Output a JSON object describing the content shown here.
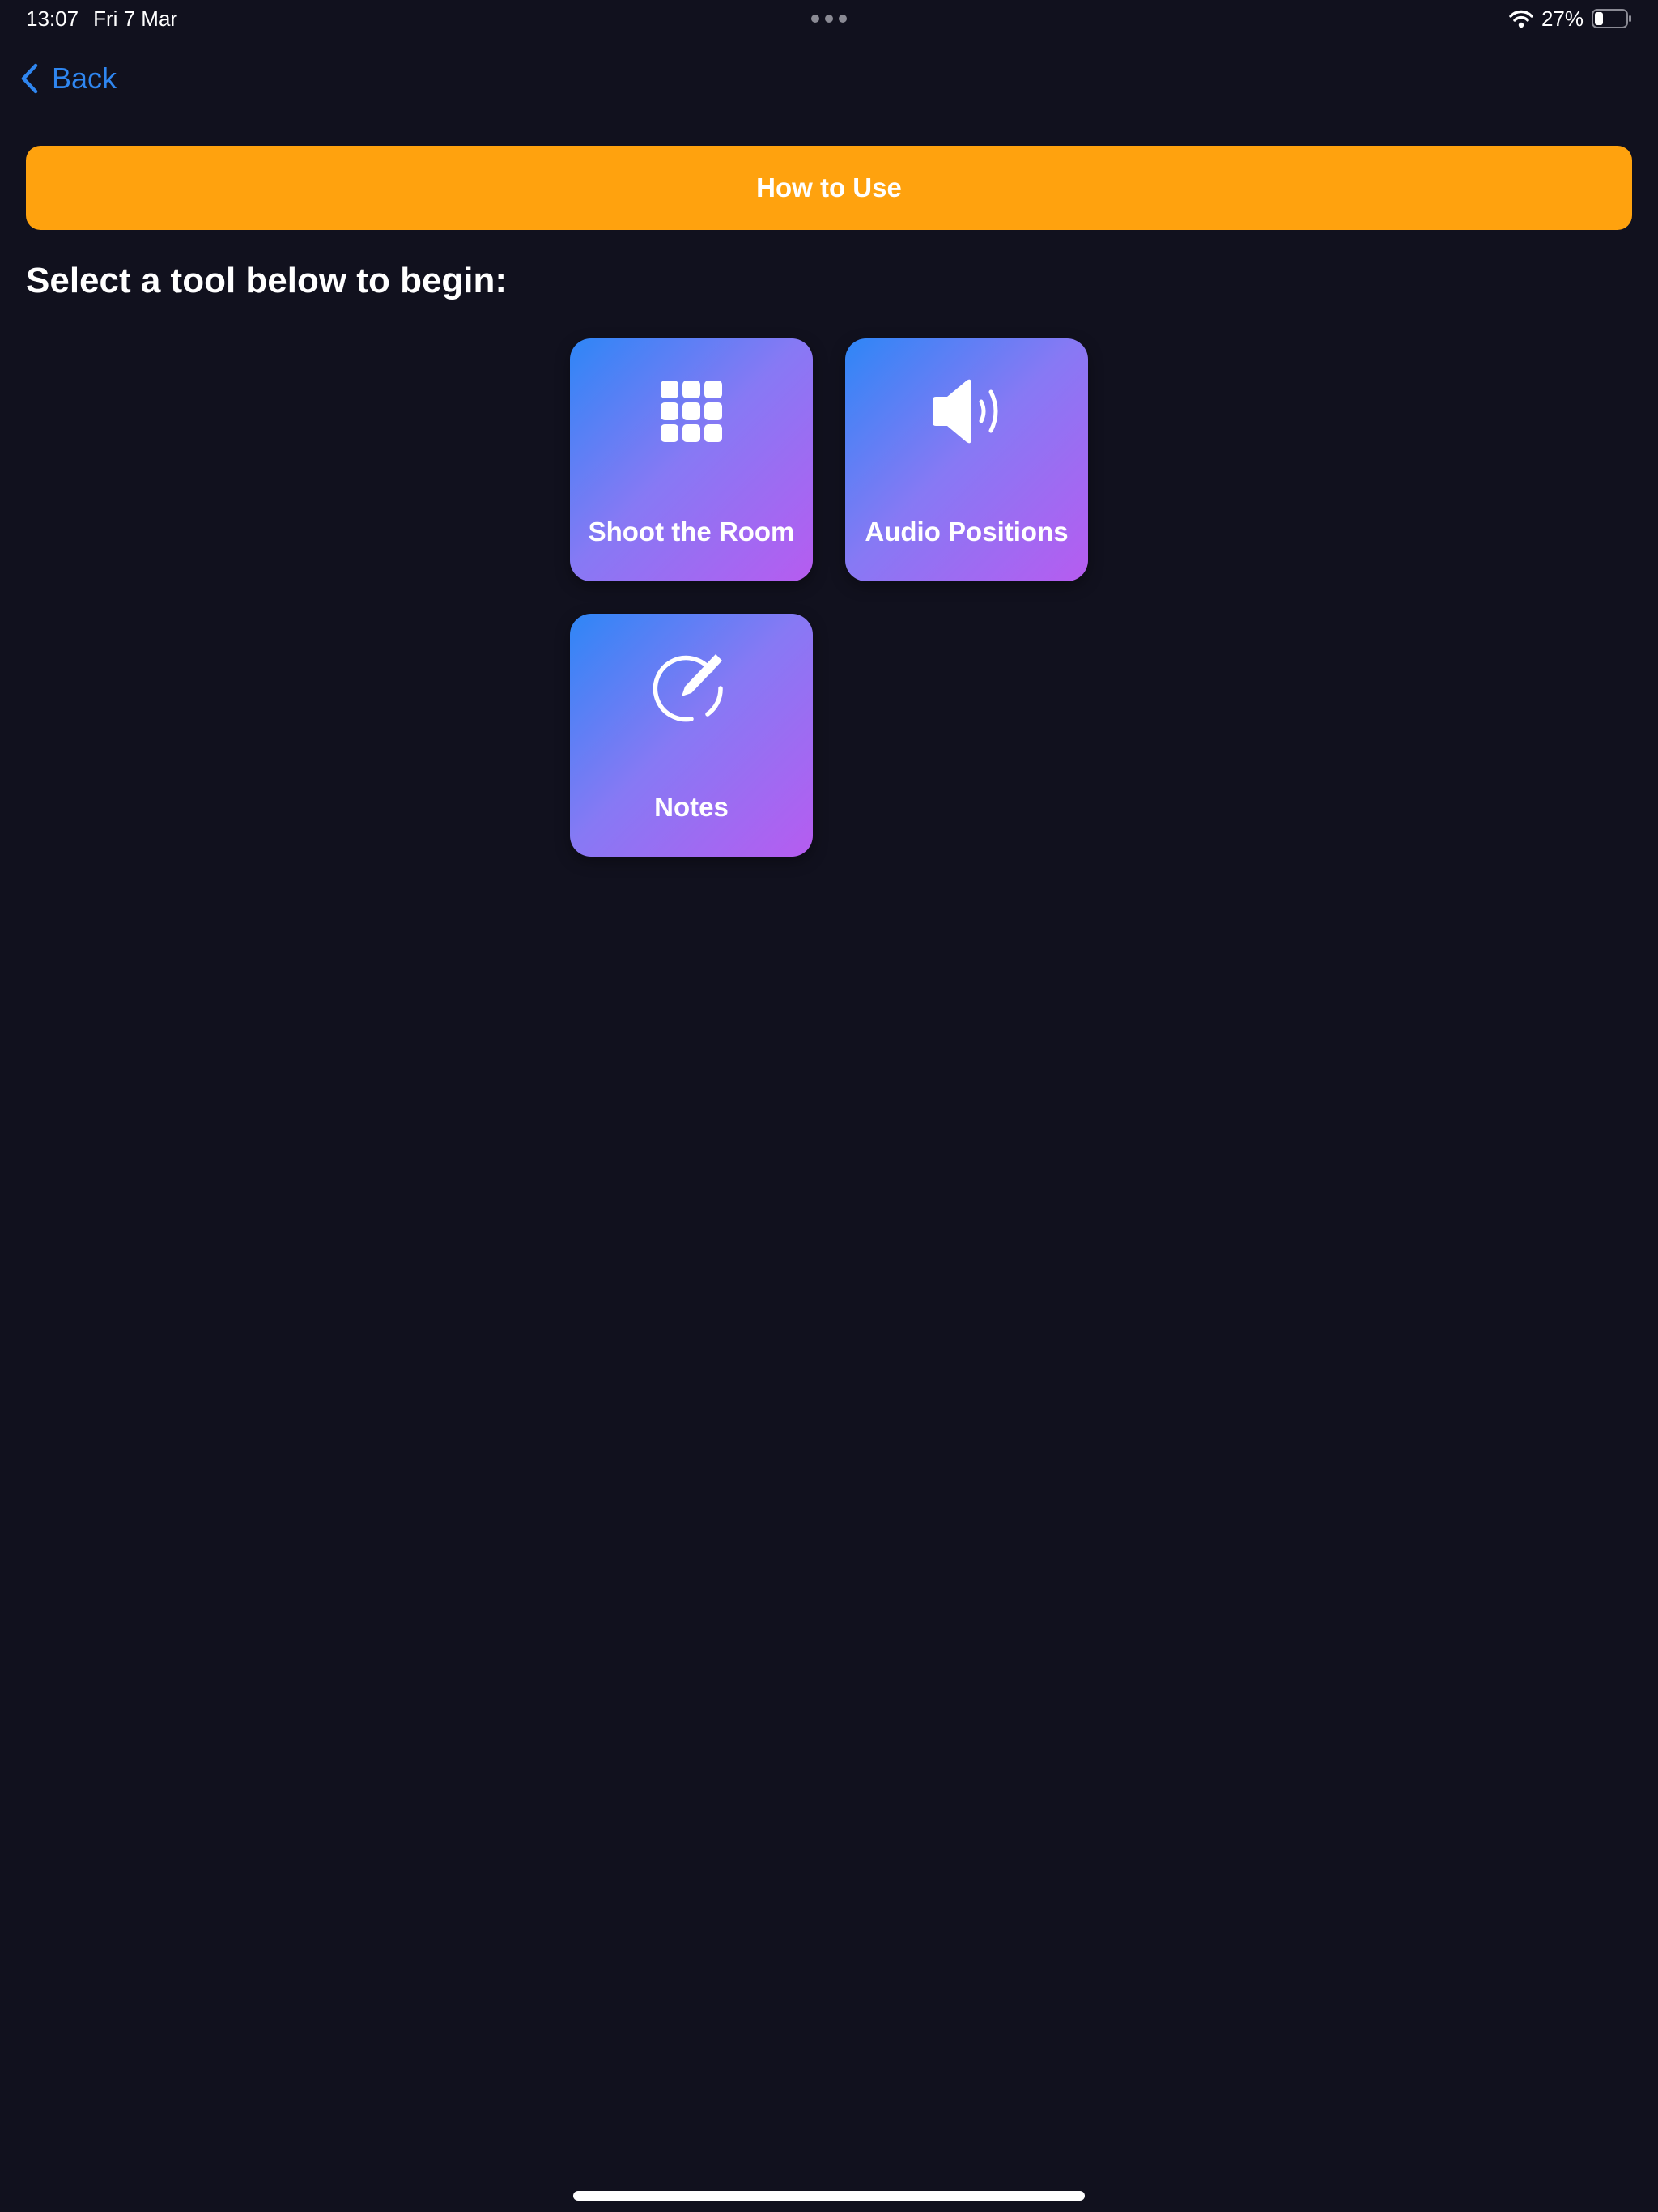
{
  "status_bar": {
    "time": "13:07",
    "date": "Fri 7 Mar",
    "battery_percent": "27%",
    "battery_level": 0.27
  },
  "nav": {
    "back_label": "Back"
  },
  "banner": {
    "label": "How to Use",
    "color": "#ffa20e"
  },
  "main": {
    "heading": "Select a tool below to begin:",
    "tools": [
      {
        "label": "Shoot the Room",
        "icon": "grid-icon"
      },
      {
        "label": "Audio Positions",
        "icon": "speaker-icon"
      },
      {
        "label": "Notes",
        "icon": "pencil-circle-icon"
      }
    ]
  },
  "colors": {
    "background": "#11111e",
    "accent_blue": "#2f86f0",
    "tile_gradient_start": "#2e86f6",
    "tile_gradient_end": "#b65cf0"
  }
}
